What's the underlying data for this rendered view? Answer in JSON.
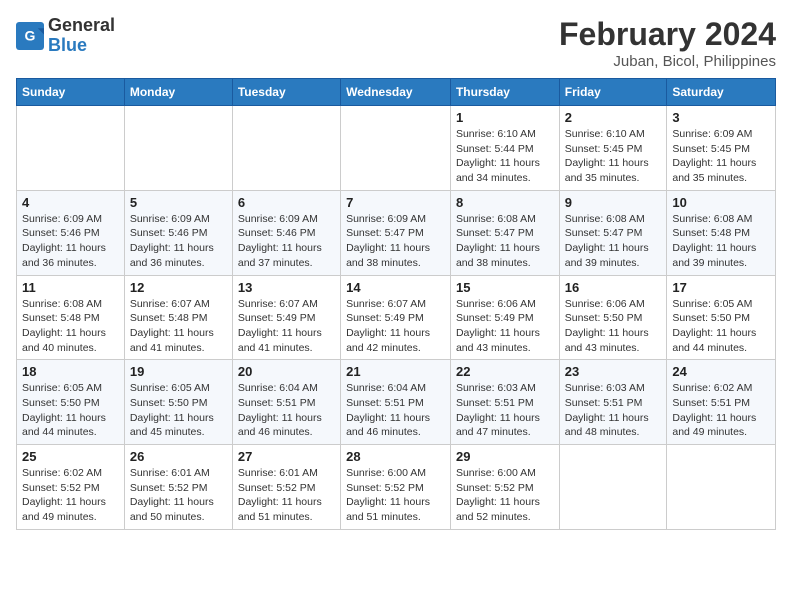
{
  "header": {
    "logo_line1": "General",
    "logo_line2": "Blue",
    "month_title": "February 2024",
    "subtitle": "Juban, Bicol, Philippines"
  },
  "weekdays": [
    "Sunday",
    "Monday",
    "Tuesday",
    "Wednesday",
    "Thursday",
    "Friday",
    "Saturday"
  ],
  "weeks": [
    [
      {
        "day": "",
        "info": ""
      },
      {
        "day": "",
        "info": ""
      },
      {
        "day": "",
        "info": ""
      },
      {
        "day": "",
        "info": ""
      },
      {
        "day": "1",
        "info": "Sunrise: 6:10 AM\nSunset: 5:44 PM\nDaylight: 11 hours\nand 34 minutes."
      },
      {
        "day": "2",
        "info": "Sunrise: 6:10 AM\nSunset: 5:45 PM\nDaylight: 11 hours\nand 35 minutes."
      },
      {
        "day": "3",
        "info": "Sunrise: 6:09 AM\nSunset: 5:45 PM\nDaylight: 11 hours\nand 35 minutes."
      }
    ],
    [
      {
        "day": "4",
        "info": "Sunrise: 6:09 AM\nSunset: 5:46 PM\nDaylight: 11 hours\nand 36 minutes."
      },
      {
        "day": "5",
        "info": "Sunrise: 6:09 AM\nSunset: 5:46 PM\nDaylight: 11 hours\nand 36 minutes."
      },
      {
        "day": "6",
        "info": "Sunrise: 6:09 AM\nSunset: 5:46 PM\nDaylight: 11 hours\nand 37 minutes."
      },
      {
        "day": "7",
        "info": "Sunrise: 6:09 AM\nSunset: 5:47 PM\nDaylight: 11 hours\nand 38 minutes."
      },
      {
        "day": "8",
        "info": "Sunrise: 6:08 AM\nSunset: 5:47 PM\nDaylight: 11 hours\nand 38 minutes."
      },
      {
        "day": "9",
        "info": "Sunrise: 6:08 AM\nSunset: 5:47 PM\nDaylight: 11 hours\nand 39 minutes."
      },
      {
        "day": "10",
        "info": "Sunrise: 6:08 AM\nSunset: 5:48 PM\nDaylight: 11 hours\nand 39 minutes."
      }
    ],
    [
      {
        "day": "11",
        "info": "Sunrise: 6:08 AM\nSunset: 5:48 PM\nDaylight: 11 hours\nand 40 minutes."
      },
      {
        "day": "12",
        "info": "Sunrise: 6:07 AM\nSunset: 5:48 PM\nDaylight: 11 hours\nand 41 minutes."
      },
      {
        "day": "13",
        "info": "Sunrise: 6:07 AM\nSunset: 5:49 PM\nDaylight: 11 hours\nand 41 minutes."
      },
      {
        "day": "14",
        "info": "Sunrise: 6:07 AM\nSunset: 5:49 PM\nDaylight: 11 hours\nand 42 minutes."
      },
      {
        "day": "15",
        "info": "Sunrise: 6:06 AM\nSunset: 5:49 PM\nDaylight: 11 hours\nand 43 minutes."
      },
      {
        "day": "16",
        "info": "Sunrise: 6:06 AM\nSunset: 5:50 PM\nDaylight: 11 hours\nand 43 minutes."
      },
      {
        "day": "17",
        "info": "Sunrise: 6:05 AM\nSunset: 5:50 PM\nDaylight: 11 hours\nand 44 minutes."
      }
    ],
    [
      {
        "day": "18",
        "info": "Sunrise: 6:05 AM\nSunset: 5:50 PM\nDaylight: 11 hours\nand 44 minutes."
      },
      {
        "day": "19",
        "info": "Sunrise: 6:05 AM\nSunset: 5:50 PM\nDaylight: 11 hours\nand 45 minutes."
      },
      {
        "day": "20",
        "info": "Sunrise: 6:04 AM\nSunset: 5:51 PM\nDaylight: 11 hours\nand 46 minutes."
      },
      {
        "day": "21",
        "info": "Sunrise: 6:04 AM\nSunset: 5:51 PM\nDaylight: 11 hours\nand 46 minutes."
      },
      {
        "day": "22",
        "info": "Sunrise: 6:03 AM\nSunset: 5:51 PM\nDaylight: 11 hours\nand 47 minutes."
      },
      {
        "day": "23",
        "info": "Sunrise: 6:03 AM\nSunset: 5:51 PM\nDaylight: 11 hours\nand 48 minutes."
      },
      {
        "day": "24",
        "info": "Sunrise: 6:02 AM\nSunset: 5:51 PM\nDaylight: 11 hours\nand 49 minutes."
      }
    ],
    [
      {
        "day": "25",
        "info": "Sunrise: 6:02 AM\nSunset: 5:52 PM\nDaylight: 11 hours\nand 49 minutes."
      },
      {
        "day": "26",
        "info": "Sunrise: 6:01 AM\nSunset: 5:52 PM\nDaylight: 11 hours\nand 50 minutes."
      },
      {
        "day": "27",
        "info": "Sunrise: 6:01 AM\nSunset: 5:52 PM\nDaylight: 11 hours\nand 51 minutes."
      },
      {
        "day": "28",
        "info": "Sunrise: 6:00 AM\nSunset: 5:52 PM\nDaylight: 11 hours\nand 51 minutes."
      },
      {
        "day": "29",
        "info": "Sunrise: 6:00 AM\nSunset: 5:52 PM\nDaylight: 11 hours\nand 52 minutes."
      },
      {
        "day": "",
        "info": ""
      },
      {
        "day": "",
        "info": ""
      }
    ]
  ]
}
